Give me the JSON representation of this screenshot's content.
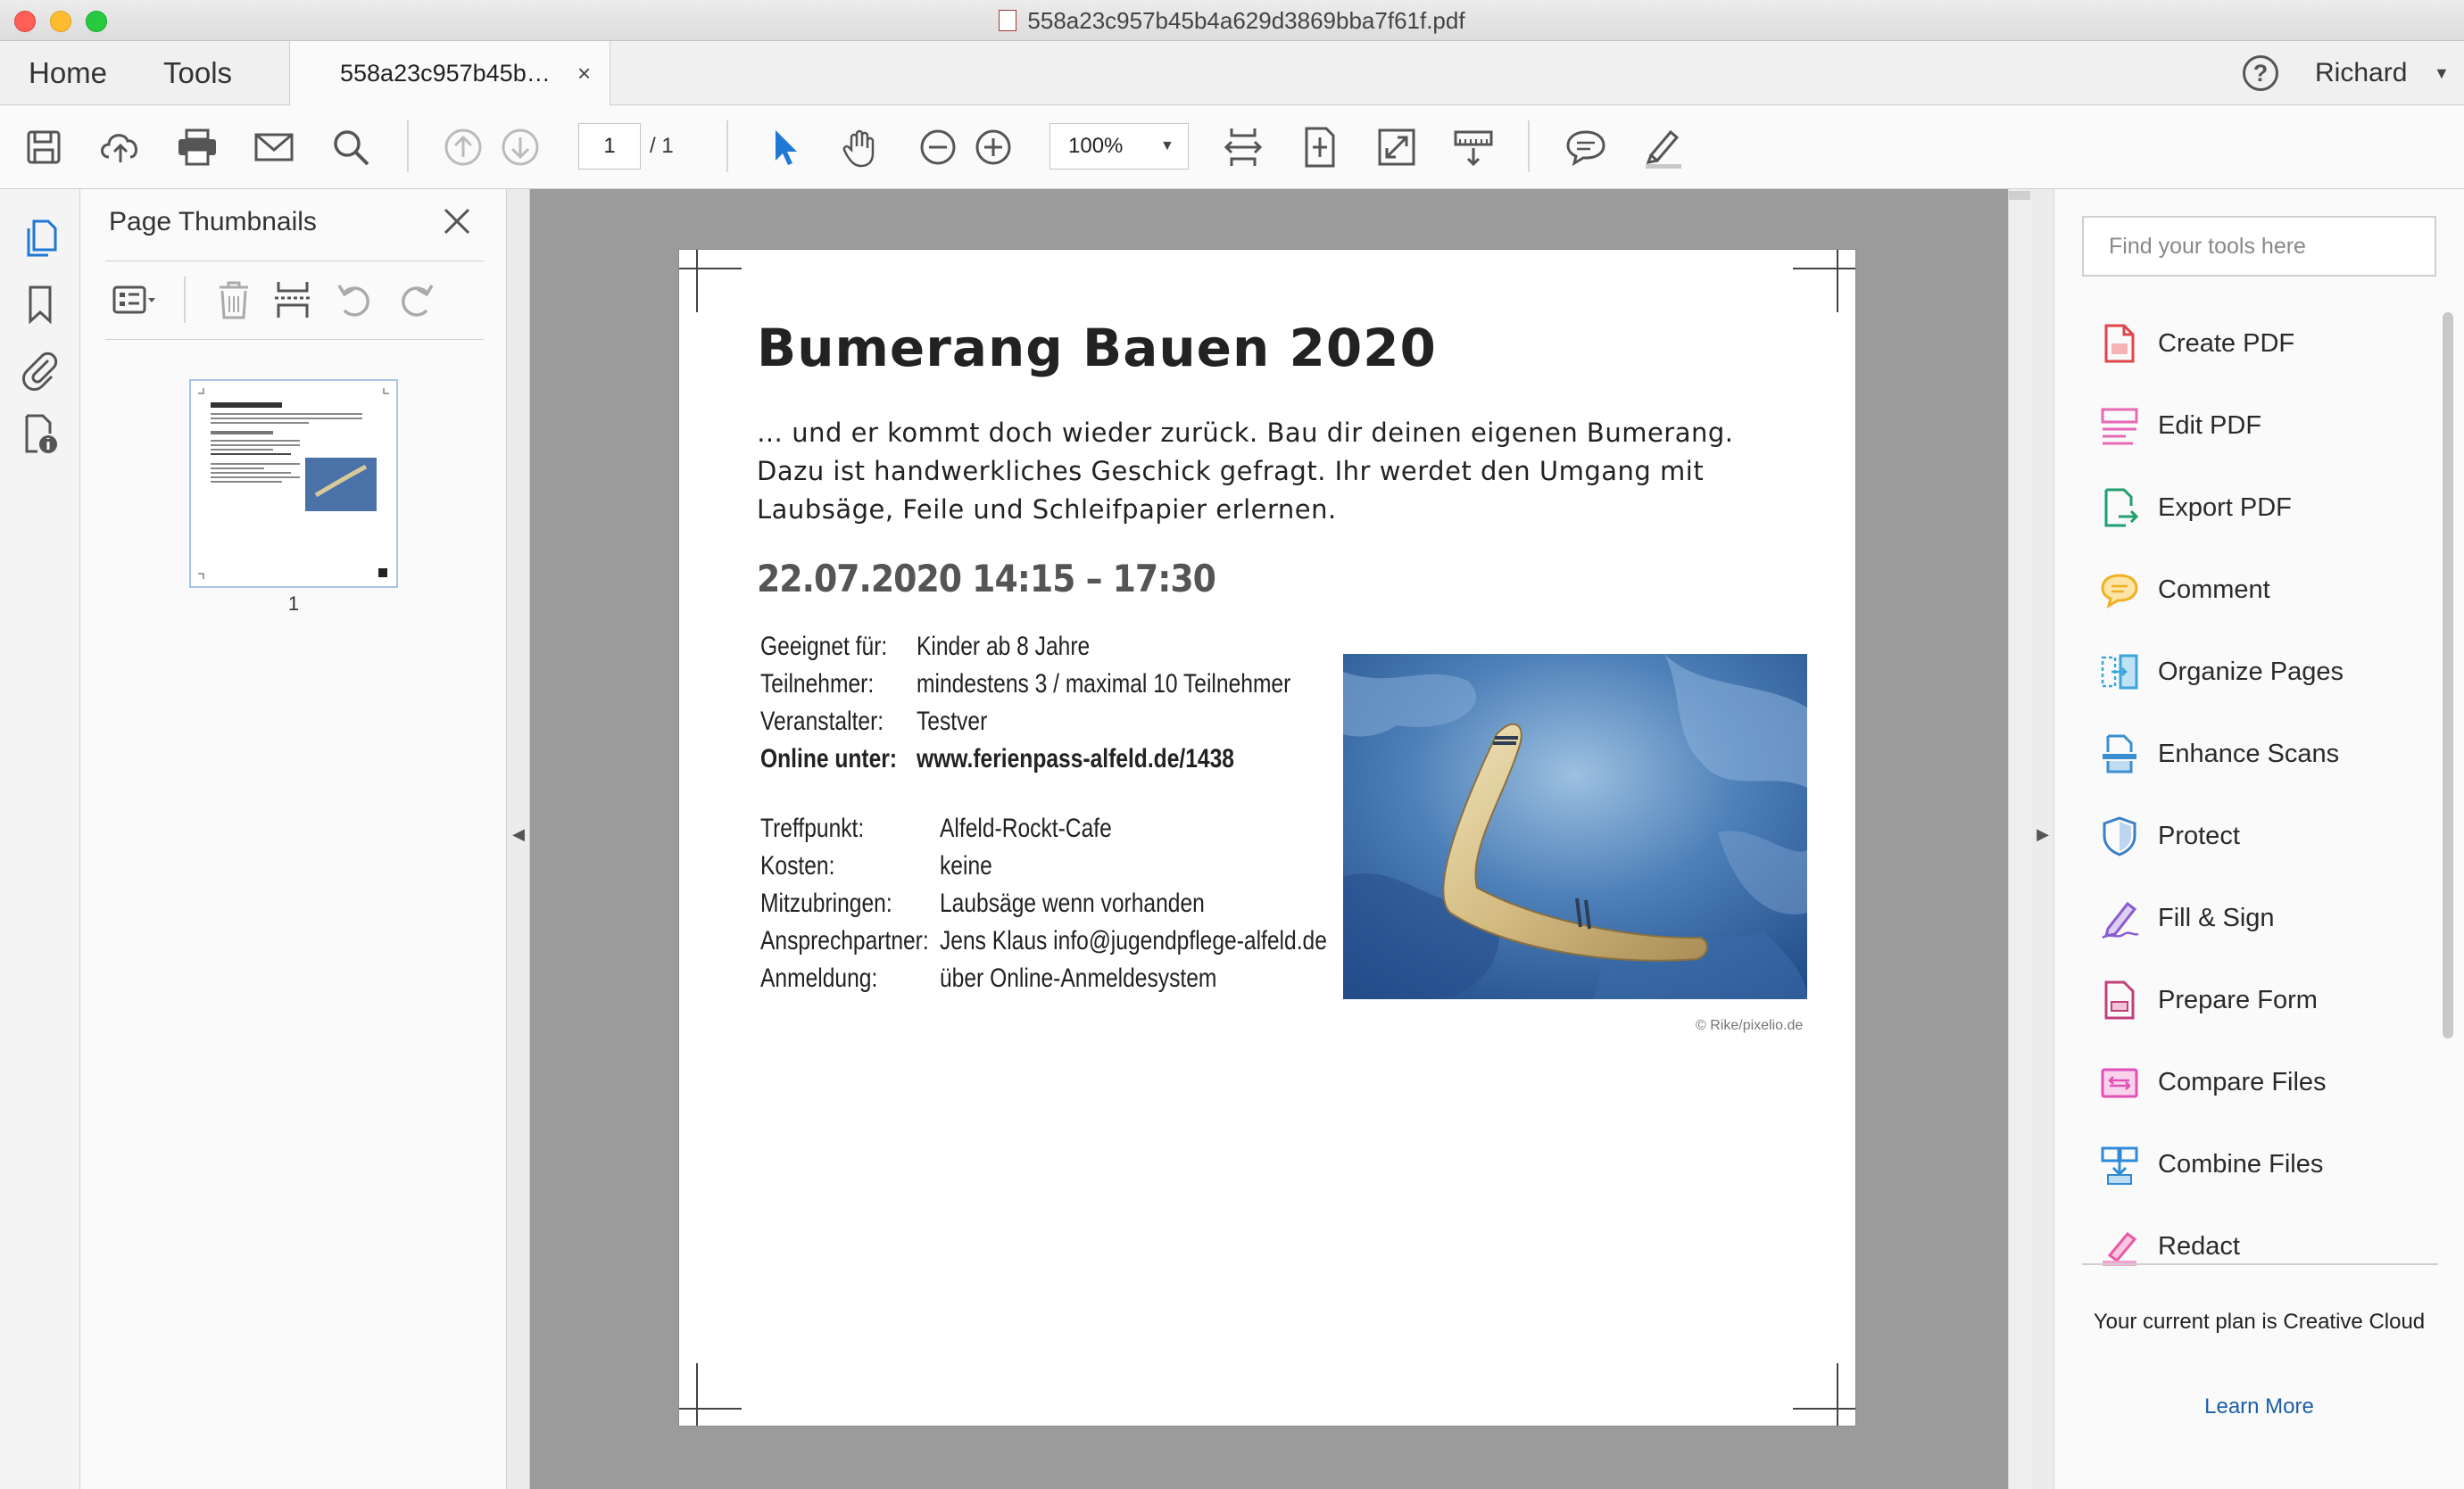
{
  "window": {
    "title": "558a23c957b45b4a629d3869bba7f61f.pdf"
  },
  "tabs": {
    "home": "Home",
    "tools": "Tools",
    "document": "558a23c957b45b…",
    "close_glyph": "×"
  },
  "header": {
    "help_glyph": "?",
    "user_name": "Richard"
  },
  "toolbar": {
    "page_current": "1",
    "page_total": "/  1",
    "zoom": "100%",
    "icons": [
      "save-icon",
      "upload-cloud-icon",
      "print-icon",
      "email-icon",
      "search-icon",
      "prev-page-icon",
      "next-page-icon",
      "select-pointer-icon",
      "hand-tool-icon",
      "zoom-out-icon",
      "zoom-in-icon",
      "fit-width-icon",
      "fit-page-icon",
      "full-screen-icon",
      "scrolling-mode-icon",
      "comment-icon",
      "highlight-pen-icon"
    ]
  },
  "left_rail": {
    "icons": [
      "page-thumbnails-icon",
      "bookmarks-icon",
      "attachments-icon",
      "document-properties-icon"
    ]
  },
  "thumbnails": {
    "title": "Page Thumbnails",
    "page_label": "1",
    "icons": [
      "thumbnail-options-icon",
      "delete-page-icon",
      "insert-page-icon",
      "rotate-ccw-icon",
      "rotate-cw-icon"
    ]
  },
  "pdf": {
    "title": "Bumerang Bauen 2020",
    "intro_lines": [
      "… und er kommt doch wieder zurück. Bau dir deinen eigenen Bumerang.",
      "Dazu ist handwerkliches Geschick gefragt. Ihr werdet den Umgang mit",
      "Laubsäge, Feile und Schleifpapier erlernen."
    ],
    "date_time": "22.07.2020 14:15 – 17:30",
    "details_1": [
      {
        "label": "Geeignet für:",
        "value": "Kinder ab 8 Jahre"
      },
      {
        "label": "Teilnehmer:",
        "value": "mindestens 3 / maximal 10 Teilnehmer"
      },
      {
        "label": "Veranstalter:",
        "value": "Testver"
      },
      {
        "label": "Online unter:",
        "value": "www.ferienpass-alfeld.de/1438"
      }
    ],
    "details_2": [
      {
        "label": "Treffpunkt:",
        "value": "Alfeld-Rockt-Cafe"
      },
      {
        "label": "Kosten:",
        "value": "keine"
      },
      {
        "label": "Mitzubringen:",
        "value": "Laubsäge wenn vorhanden"
      },
      {
        "label": "Ansprechpartner:",
        "value": "Jens Klaus info@jugendpflege-alfeld.de"
      },
      {
        "label": "Anmeldung:",
        "value": "über Online-Anmeldesystem"
      }
    ],
    "photo_credit": "© Rike/pixelio.de"
  },
  "tools_pane": {
    "search_placeholder": "Find your tools here",
    "items": [
      {
        "label": "Create PDF",
        "icon": "create-pdf-icon",
        "color": "#e0464b"
      },
      {
        "label": "Edit PDF",
        "icon": "edit-pdf-icon",
        "color": "#e868b8"
      },
      {
        "label": "Export PDF",
        "icon": "export-pdf-icon",
        "color": "#1f9e6e"
      },
      {
        "label": "Comment",
        "icon": "comment-tool-icon",
        "color": "#f0b023"
      },
      {
        "label": "Organize Pages",
        "icon": "organize-pages-icon",
        "color": "#3aa5d9"
      },
      {
        "label": "Enhance Scans",
        "icon": "enhance-scans-icon",
        "color": "#3a8fd0"
      },
      {
        "label": "Protect",
        "icon": "protect-shield-icon",
        "color": "#3a7fc8"
      },
      {
        "label": "Fill & Sign",
        "icon": "fill-sign-icon",
        "color": "#8a5ad0"
      },
      {
        "label": "Prepare Form",
        "icon": "prepare-form-icon",
        "color": "#c0407a"
      },
      {
        "label": "Compare Files",
        "icon": "compare-files-icon",
        "color": "#e050b8"
      },
      {
        "label": "Combine Files",
        "icon": "combine-files-icon",
        "color": "#2f8ad8"
      },
      {
        "label": "Redact",
        "icon": "redact-icon",
        "color": "#e85aa6"
      }
    ],
    "plan_text": "Your current plan is Creative Cloud",
    "learn_more": "Learn More"
  }
}
